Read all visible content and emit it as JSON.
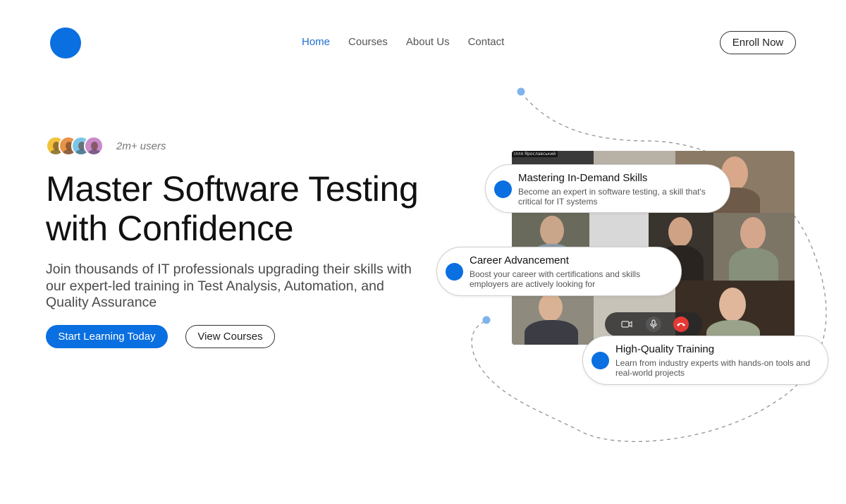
{
  "header": {
    "nav": [
      {
        "label": "Home",
        "active": true
      },
      {
        "label": "Courses",
        "active": false
      },
      {
        "label": "About Us",
        "active": false
      },
      {
        "label": "Contact",
        "active": false
      }
    ],
    "cta": "Enroll Now"
  },
  "hero": {
    "users_text": "2m+ users",
    "title_line1": "Master Software Testing",
    "title_line2": "with Confidence",
    "subtitle": "Join thousands of IT professionals upgrading their skills with our expert-led training in Test Analysis, Automation, and Quality Assurance",
    "primary_cta": "Start Learning Today",
    "secondary_cta": "View Courses"
  },
  "video_call": {
    "camera_label": "Ілля Ярославський"
  },
  "features": [
    {
      "title": "Mastering In-Demand Skills",
      "description": "Become an expert in software testing, a skill that's critical for IT systems"
    },
    {
      "title": "Career Advancement",
      "description": "Boost your career with certifications and skills employers are actively looking for"
    },
    {
      "title": "High-Quality Training",
      "description": "Learn from industry experts with hands-on tools and real-world projects"
    }
  ],
  "colors": {
    "accent": "#0a6fe0",
    "nav_active": "#1f6fd4",
    "end_call": "#e53935"
  }
}
